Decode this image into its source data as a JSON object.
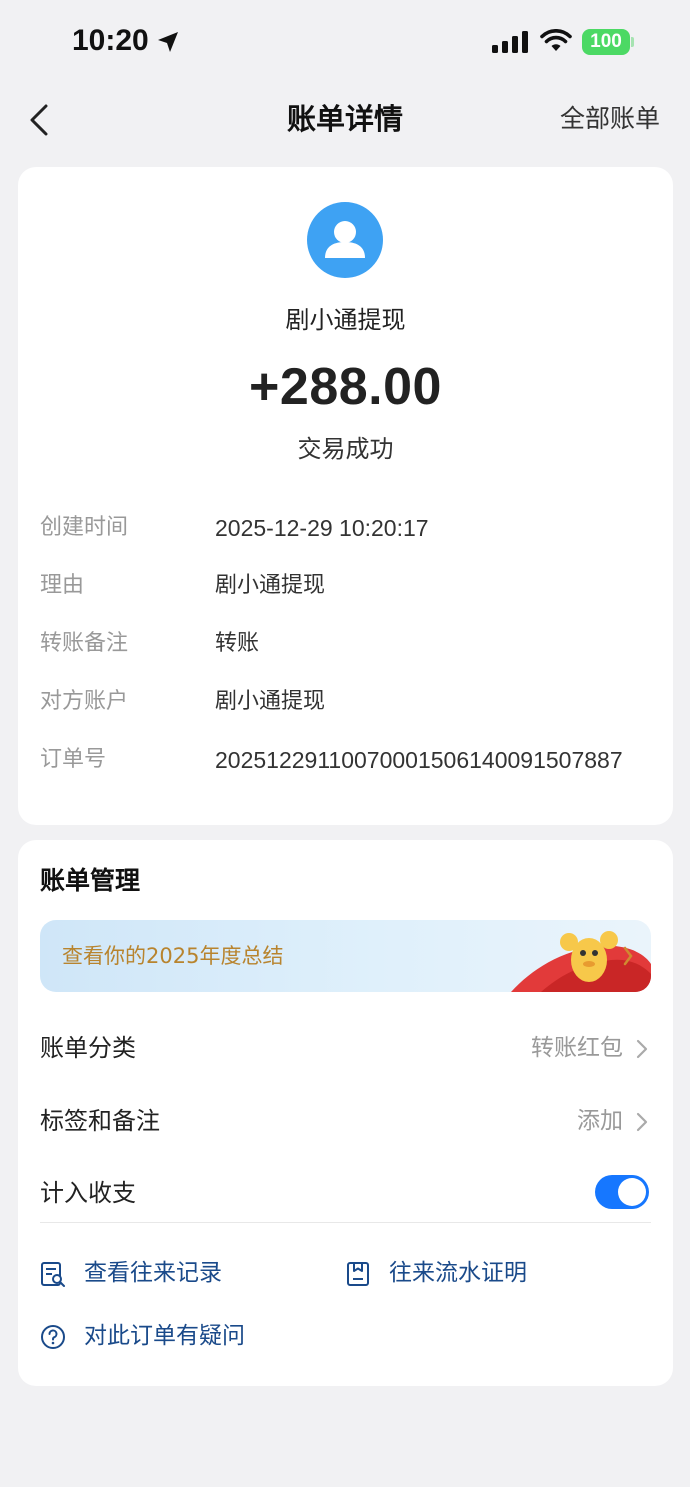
{
  "status_bar": {
    "time": "10:20",
    "battery": "100",
    "icons": [
      "location-arrow-icon",
      "signal-icon",
      "wifi-icon",
      "battery-icon"
    ]
  },
  "nav": {
    "back_icon": "chevron-left-icon",
    "title": "账单详情",
    "right_link": "全部账单"
  },
  "transaction": {
    "avatar_icon": "user-avatar-icon",
    "party_name": "剧小通提现",
    "amount": "+288.00",
    "status": "交易成功",
    "details": [
      {
        "label": "创建时间",
        "value": "2025-12-29 10:20:17"
      },
      {
        "label": "理由",
        "value": "剧小通提现"
      },
      {
        "label": "转账备注",
        "value": "转账"
      },
      {
        "label": "对方账户",
        "value": "剧小通提现"
      },
      {
        "label": "订单号",
        "value": "20251229110070001506140091507887"
      }
    ]
  },
  "management": {
    "title": "账单管理",
    "banner_text": "查看你的2025年度总结",
    "rows": [
      {
        "label": "账单分类",
        "value": "转账红包"
      },
      {
        "label": "标签和备注",
        "value": "添加"
      },
      {
        "label": "计入收支",
        "toggle_on": true
      }
    ],
    "links": [
      {
        "text": "查看往来记录",
        "icon": "record-search-icon"
      },
      {
        "text": "往来流水证明",
        "icon": "statement-proof-icon"
      },
      {
        "text": "对此订单有疑问",
        "icon": "question-circle-icon"
      }
    ]
  },
  "colors": {
    "accent": "#1677ff",
    "avatar_bg": "#3ea2f3",
    "link": "#1a4a8a",
    "banner_text": "#b8842e",
    "battery": "#4cd964",
    "page_bg": "#f1f1f3"
  }
}
